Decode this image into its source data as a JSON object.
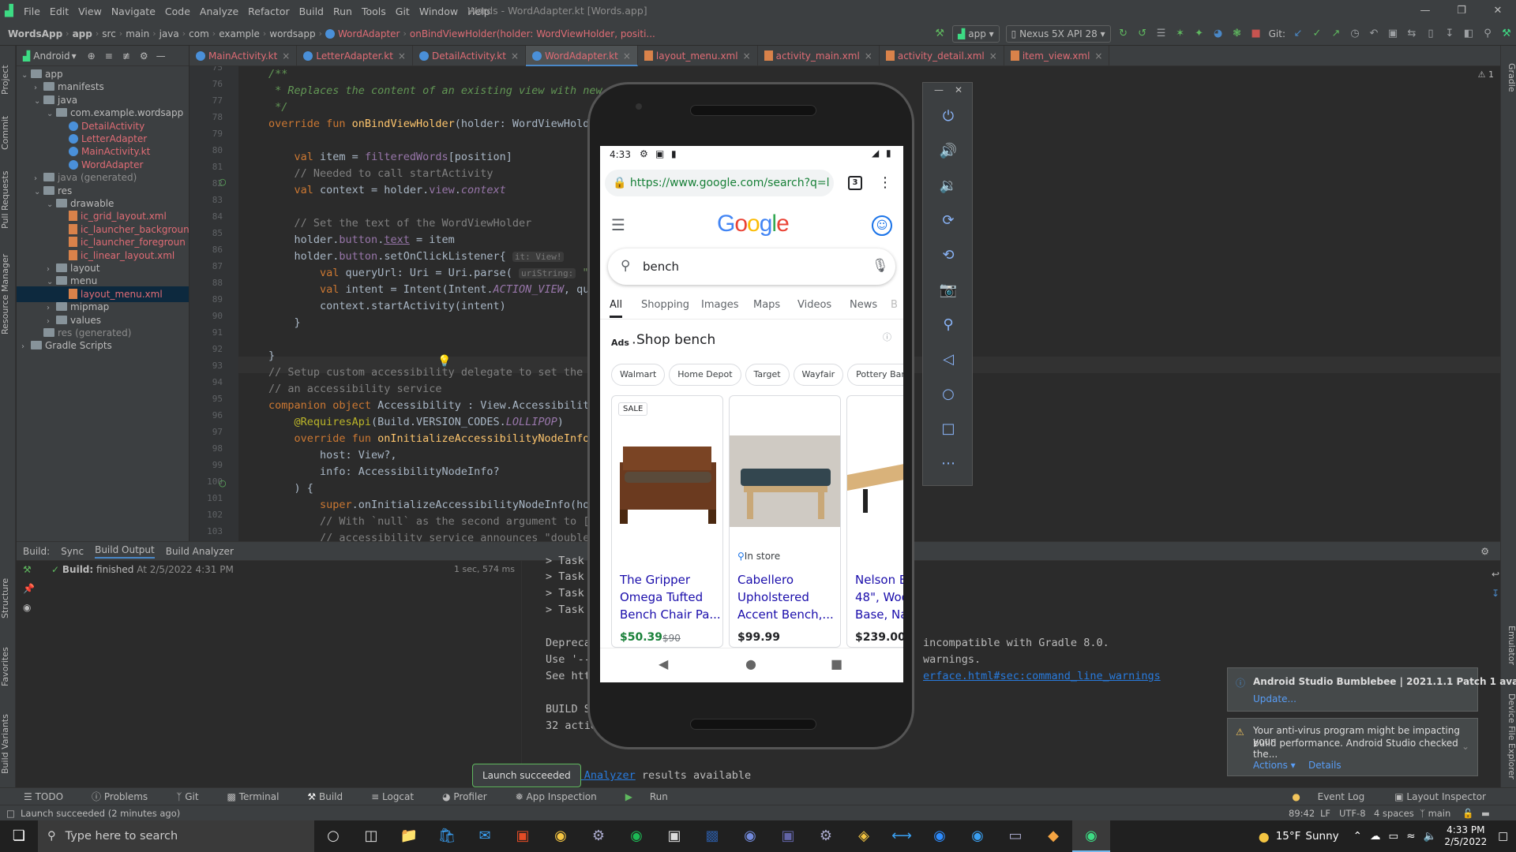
{
  "menubar": {
    "items": [
      "File",
      "Edit",
      "View",
      "Navigate",
      "Code",
      "Analyze",
      "Refactor",
      "Build",
      "Run",
      "Tools",
      "Git",
      "Window",
      "Help"
    ],
    "window_title": "Words - WordAdapter.kt [Words.app]"
  },
  "navbar": {
    "crumbs": [
      "WordsApp",
      "app",
      "src",
      "main",
      "java",
      "com",
      "example",
      "wordsapp",
      "WordAdapter"
    ],
    "function_crumb": "onBindViewHolder(holder: WordViewHolder, positi...",
    "run_config": "app",
    "device": "Nexus 5X API 28",
    "git_label": "Git:"
  },
  "project": {
    "header": "Android",
    "tree": [
      {
        "label": "app",
        "indent": 0,
        "type": "folder",
        "open": true
      },
      {
        "label": "manifests",
        "indent": 1,
        "type": "folder",
        "open": false
      },
      {
        "label": "java",
        "indent": 1,
        "type": "folder",
        "open": true
      },
      {
        "label": "com.example.wordsapp",
        "indent": 2,
        "type": "folder",
        "open": true
      },
      {
        "label": "DetailActivity",
        "indent": 3,
        "type": "kotlin"
      },
      {
        "label": "LetterAdapter",
        "indent": 3,
        "type": "kotlin"
      },
      {
        "label": "MainActivity.kt",
        "indent": 3,
        "type": "kotlin"
      },
      {
        "label": "WordAdapter",
        "indent": 3,
        "type": "kotlin"
      },
      {
        "label": "java (generated)",
        "indent": 1,
        "type": "folder",
        "open": false
      },
      {
        "label": "res",
        "indent": 1,
        "type": "folder",
        "open": true
      },
      {
        "label": "drawable",
        "indent": 2,
        "type": "folder",
        "open": true
      },
      {
        "label": "ic_grid_layout.xml",
        "indent": 3,
        "type": "xml"
      },
      {
        "label": "ic_launcher_backgroun",
        "indent": 3,
        "type": "xml"
      },
      {
        "label": "ic_launcher_foregroun",
        "indent": 3,
        "type": "xml"
      },
      {
        "label": "ic_linear_layout.xml",
        "indent": 3,
        "type": "xml"
      },
      {
        "label": "layout",
        "indent": 2,
        "type": "folder",
        "open": false
      },
      {
        "label": "menu",
        "indent": 2,
        "type": "folder",
        "open": true
      },
      {
        "label": "layout_menu.xml",
        "indent": 3,
        "type": "xml",
        "selected": true
      },
      {
        "label": "mipmap",
        "indent": 2,
        "type": "folder",
        "open": false
      },
      {
        "label": "values",
        "indent": 2,
        "type": "folder",
        "open": false
      },
      {
        "label": "res (generated)",
        "indent": 1,
        "type": "folder",
        "open": null
      },
      {
        "label": "Gradle Scripts",
        "indent": 0,
        "type": "gradle",
        "open": false
      }
    ]
  },
  "tabs": [
    "MainActivity.kt",
    "LetterAdapter.kt",
    "DetailActivity.kt",
    "WordAdapter.kt",
    "layout_menu.xml",
    "activity_main.xml",
    "activity_detail.xml",
    "item_view.xml"
  ],
  "active_tab": 3,
  "editor": {
    "line_numbers": [
      "75",
      "76",
      "77",
      "78",
      "79",
      "80",
      "81",
      "82",
      "83",
      "84",
      "85",
      "86",
      "87",
      "88",
      "89",
      "90",
      "91",
      "92",
      "93",
      "94",
      "95",
      "96",
      "97",
      "98",
      "99",
      "100",
      "101",
      "102",
      "103"
    ],
    "warnings": "⚠ 1",
    "lines": {
      "l75": "/**",
      "l76": " * Replaces the content of an existing view with new d",
      "l77": " */",
      "l78a": "override fun ",
      "l78b": "onBindViewHolder",
      "l78c": "(holder: WordViewHolder,",
      "l80a": "    val ",
      "l80b": "item = ",
      "l80c": "filteredWords",
      "l80d": "[position]",
      "l81": "    // Needed to call startActivity",
      "l82a": "    val ",
      "l82b": "context = holder.",
      "l82c": "view",
      "l82d": ".",
      "l82e": "context",
      "l84": "    // Set the text of the WordViewHolder",
      "l85a": "    holder.",
      "l85b": "button",
      "l85c": ".",
      "l85d": "text",
      "l85e": " = item",
      "l86a": "    holder.",
      "l86b": "button",
      "l86c": ".setOnClickListener{ ",
      "l86h": "it: View!",
      "l87a": "        val ",
      "l87b": "queryUrl: Uri = Uri.parse( ",
      "l87h": "uriString:",
      "l87c": " \"${De",
      "l88a": "        val ",
      "l88b": "intent = Intent(Intent.",
      "l88c": "ACTION_VIEW",
      ", qu": "",
      "l88d": ", qu",
      "l89": "        context.startActivity(intent)",
      "l90": "    }",
      "l92": "}",
      "l93": "// Setup custom accessibility delegate to set the",
      "l94": "// an accessibility service",
      "l95a": "companion object ",
      "l95b": "Accessibility : View.Accessibilit",
      "l96a": "    @RequiresApi",
      "l96b": "(Build.VERSION_CODES.",
      "l96c": "LOLLIPOP",
      ")": ")",
      "l97a": "    override fun ",
      "l97b": "onInitializeAccessibilityNodeInfo(",
      "l98": "        host: View?,",
      "l99": "        info: AccessibilityNodeInfo?",
      "l100": "    ) {",
      "l101a": "        super",
      "l101b": ".onInitializeAccessibilityNodeInfo(ho",
      "l102": "        // With `null` as the second argument to [",
      "l103": "        // accessibility service announces \"double"
    }
  },
  "build": {
    "tabs": [
      "Build:",
      "Sync",
      "Build Output",
      "Build Analyzer"
    ],
    "status_bold": "Build:",
    "status": "finished",
    "status_time": "At 2/5/2022 4:31 PM",
    "duration": "1 sec, 574 ms",
    "output": [
      "> Task :a",
      "> Task :a",
      "> Task :a",
      "> Task :a",
      "",
      "Deprecate",
      "Use '--wa",
      "See https",
      "",
      "BUILD SUC",
      "32 action"
    ],
    "output_right": [
      "incompatible with Gradle 8.0.",
      "warnings.",
      "erface.html#sec:command_line_warnings"
    ],
    "analyzer_link": "Build Analyzer",
    "analyzer_text": " results available"
  },
  "tooltip": "Launch succeeded",
  "toolbar": [
    "TODO",
    "Problems",
    "Git",
    "Terminal",
    "Build",
    "Logcat",
    "Profiler",
    "App Inspection",
    "Run"
  ],
  "toolbar_right": [
    "Event Log",
    "Layout Inspector"
  ],
  "statusbar": {
    "left": "Launch succeeded (2 minutes ago)",
    "position": "89:42",
    "lf": "LF",
    "encoding": "UTF-8",
    "indent": "4 spaces",
    "branch": "main"
  },
  "left_vtabs": [
    "Project",
    "Commit",
    "Pull Requests",
    "Resource Manager",
    "Structure",
    "Favorites",
    "Build Variants"
  ],
  "right_vtabs": [
    "Gradle",
    "Emulator",
    "Device File Explorer"
  ],
  "notifications": {
    "n1": {
      "title": "Android Studio Bumblebee | 2021.1.1 Patch 1 avai",
      "link": "Update..."
    },
    "n2": {
      "text1": "Your anti-virus program might be impacting your",
      "text2": "build performance. Android Studio checked the...",
      "action1": "Actions",
      "action2": "Details"
    }
  },
  "phone": {
    "time": "4:33",
    "url": "https://www.google.com/search?q=l",
    "tab_count": "3",
    "search": "bench",
    "search_tabs": [
      "All",
      "Shopping",
      "Images",
      "Maps",
      "Videos",
      "News",
      "B"
    ],
    "ads_label": "Ads ·",
    "shop_title": "Shop bench",
    "chips": [
      "Walmart",
      "Home Depot",
      "Target",
      "Wayfair",
      "Pottery Barn"
    ],
    "products": [
      {
        "badge": "SALE",
        "title1": "The Gripper",
        "title2": "Omega Tufted",
        "title3": "Bench Chair Pa...",
        "price": "$50.39",
        "old_price": "$90"
      },
      {
        "badge": "In store",
        "title1": "Cabellero",
        "title2": "Upholstered",
        "title3": "Accent Bench,...",
        "price": "$99.99",
        "old_price": ""
      },
      {
        "badge": "",
        "title1": "Nelson B",
        "title2": "48\", Woo",
        "title3": "Base, Na",
        "price": "$239.00",
        "old_price": ""
      }
    ]
  },
  "taskbar": {
    "search_placeholder": "Type here to search",
    "weather_temp": "15°F",
    "weather_text": "Sunny",
    "time": "4:33 PM",
    "date": "2/5/2022"
  }
}
